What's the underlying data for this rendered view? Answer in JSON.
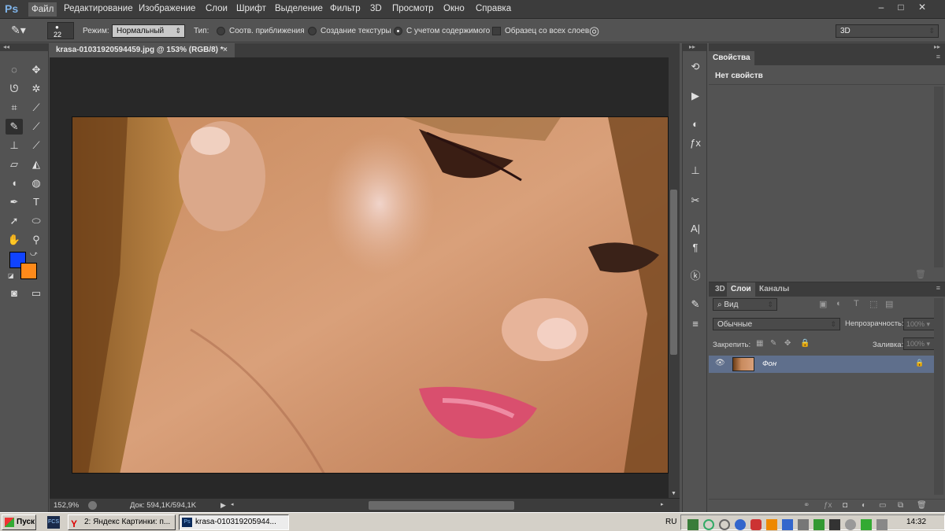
{
  "app": {
    "logo": "Ps"
  },
  "menu": [
    "Файл",
    "Редактирование",
    "Изображение",
    "Слои",
    "Шрифт",
    "Выделение",
    "Фильтр",
    "3D",
    "Просмотр",
    "Окно",
    "Справка"
  ],
  "window_controls": [
    "–",
    "□",
    "✕"
  ],
  "options": {
    "brush_size": "22",
    "mode_label": "Режим:",
    "mode_value": "Нормальный",
    "type_label": "Тип:",
    "type_options": [
      "Соотв. приближения",
      "Создание текстуры",
      "С учетом содержимого"
    ],
    "selected_type": "С учетом содержимого",
    "sample_all_label": "Образец со всех слоев",
    "workspace": "3D"
  },
  "document": {
    "tab_title": "krasa-01031920594459.jpg @ 153% (RGB/8) *",
    "zoom": "152,9%",
    "doc_info": "Док: 594,1K/594,1K"
  },
  "colors": {
    "foreground": "#1043ff",
    "background": "#ff8a1a",
    "selected_layer": "#5f6f8c"
  },
  "properties_panel": {
    "tab": "Свойства",
    "content": "Нет свойств"
  },
  "layers_panel": {
    "tabs": [
      "3D",
      "Слои",
      "Каналы"
    ],
    "filter_kind": "Вид",
    "blend_mode": "Обычные",
    "opacity_label": "Непрозрачность:",
    "opacity_value": "100%",
    "lock_label": "Закрепить:",
    "fill_label": "Заливка:",
    "fill_value": "100%",
    "layers": [
      {
        "name": "Фон",
        "locked": true,
        "visible": true
      }
    ]
  },
  "taskbar": {
    "start": "Пуск",
    "tasks": [
      "2: Яндекс Картинки: п...",
      "krasa-010319205944..."
    ],
    "lang": "RU",
    "time": "14:32"
  }
}
